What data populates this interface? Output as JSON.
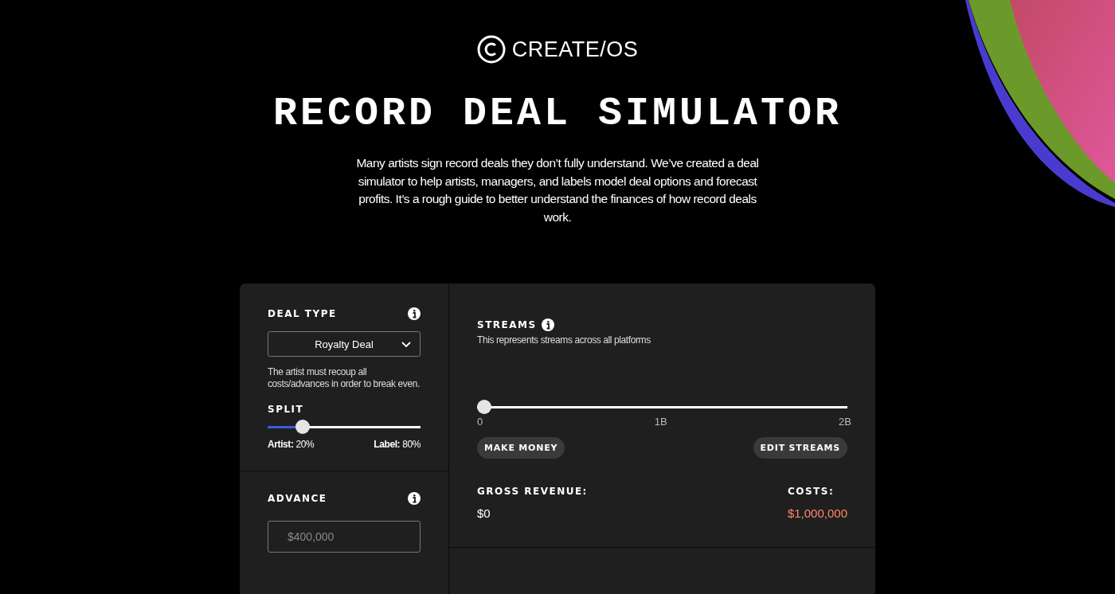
{
  "logo": {
    "text": "CREATE/OS"
  },
  "title": "RECORD DEAL SIMULATOR",
  "intro": "Many artists sign record deals they don’t fully understand. We’ve created a deal simulator to help artists, managers, and labels model deal options and forecast profits. It’s a rough guide to better understand the finances of how record deals work.",
  "deal_type": {
    "label": "DEAL TYPE",
    "value": "Royalty Deal",
    "description": "The artist must recoup all costs/advances in order to break even."
  },
  "split": {
    "label": "SPLIT",
    "level": 0.2,
    "artist_label": "Artist:",
    "artist_value": "20%",
    "label_label": "Label:",
    "label_value": "80%"
  },
  "advance": {
    "label": "ADVANCE",
    "placeholder": "$400,000"
  },
  "streams": {
    "label": "STREAMS",
    "description": "This represents streams across all platforms",
    "level": 0,
    "ticks": [
      "0",
      "1B",
      "2B"
    ]
  },
  "buttons": [
    {
      "label": "MAKE MONEY"
    },
    {
      "label": "EDIT STREAMS"
    }
  ],
  "gross_revenue": {
    "label": "GROSS REVENUE:",
    "value": "$0"
  },
  "costs": {
    "label": "COSTS:",
    "value": "$1,000,000"
  }
}
